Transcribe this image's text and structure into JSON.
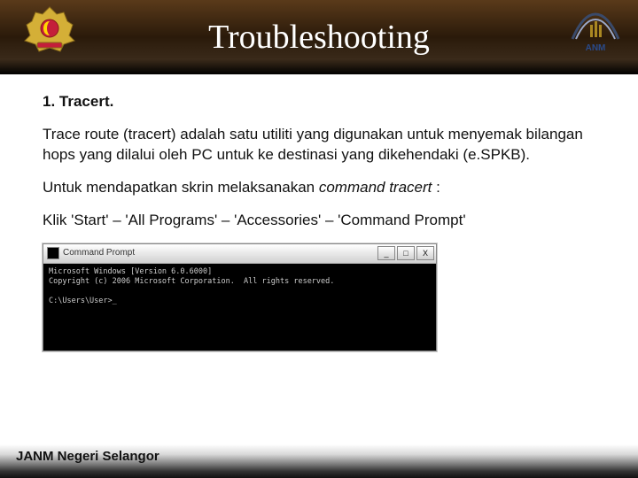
{
  "header": {
    "title": "Troubleshooting",
    "anm_label": "ANM"
  },
  "content": {
    "subtitle": "1. Tracert.",
    "para1": "Trace route (tracert) adalah satu utiliti yang digunakan untuk menyemak  bilangan hops yang dilalui oleh PC untuk ke destinasi yang dikehendaki  (e.SPKB).",
    "para2_a": "Untuk mendapatkan skrin melaksanakan  ",
    "para2_b": "command tracert",
    "para2_c": " :",
    "para3": "Klik 'Start' – 'All Programs' – 'Accessories' – 'Command Prompt'"
  },
  "cmd": {
    "title": "Command Prompt",
    "min": "_",
    "max": "□",
    "close": "X",
    "line1": "Microsoft Windows [Version 6.0.6000]",
    "line2": "Copyright (c) 2006 Microsoft Corporation.  All rights reserved.",
    "line3": "",
    "line4": "C:\\Users\\User>_"
  },
  "footer": {
    "text": "JANM Negeri Selangor"
  }
}
